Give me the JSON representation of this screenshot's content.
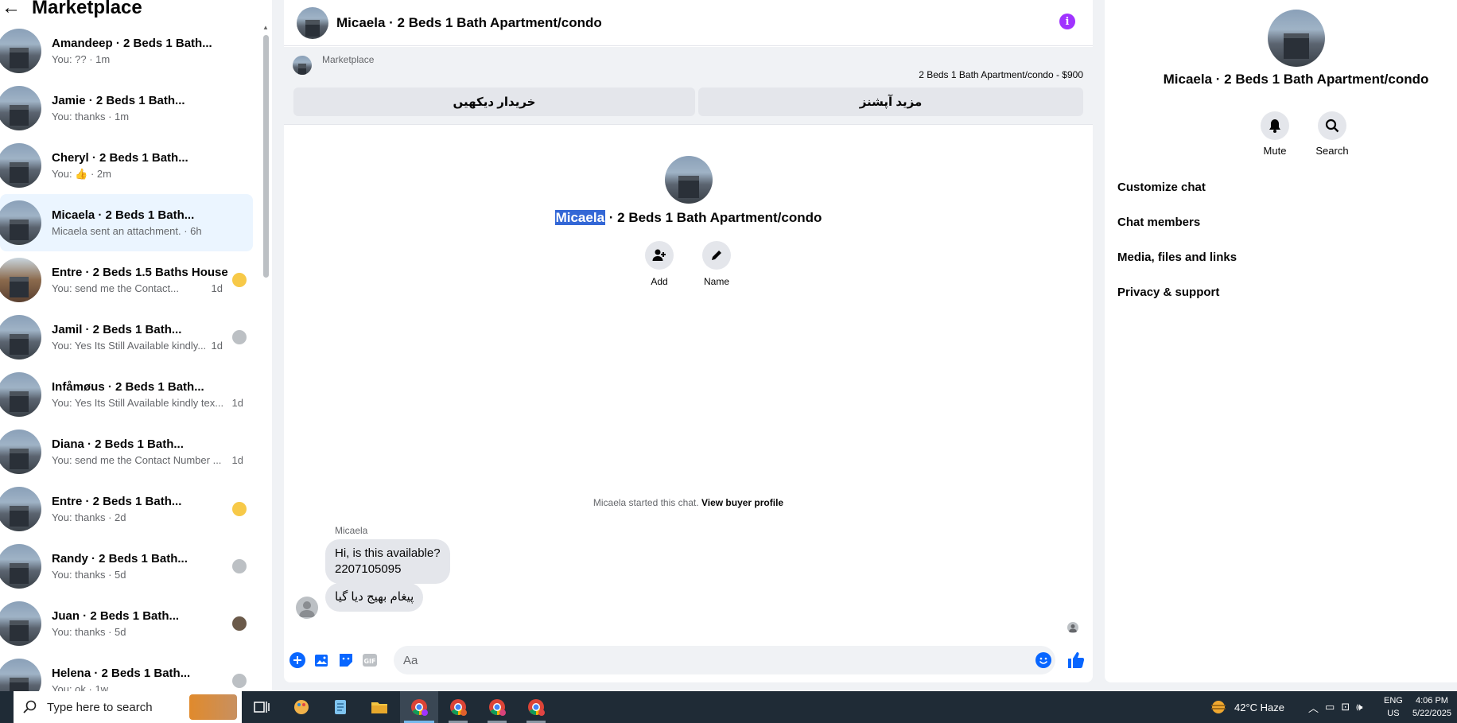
{
  "sidebar": {
    "title": "Marketplace",
    "conversations": [
      {
        "name": "Amandeep · 2 Beds 1 Bath...",
        "preview": "You: ?? · 1m",
        "badge": ""
      },
      {
        "name": "Jamie · 2 Beds 1 Bath...",
        "preview": "You: thanks · 1m",
        "badge": ""
      },
      {
        "name": "Cheryl · 2 Beds 1 Bath...",
        "preview": "You: 👍 · 2m",
        "badge": ""
      },
      {
        "name": "Micaela · 2 Beds 1 Bath...",
        "preview": "Micaela sent an attachment. · 6h",
        "badge": ""
      },
      {
        "name": "Entre · 2 Beds 1.5 Baths House",
        "preview": "You: send me the Contact...",
        "time": "1d",
        "badge": "emoji"
      },
      {
        "name": "Jamil · 2 Beds 1 Bath...",
        "preview": "You: Yes Its Still Available kindly...",
        "time": "1d",
        "badge": "person"
      },
      {
        "name": "Infåmøus · 2 Beds 1 Bath...",
        "preview": "You: Yes Its Still Available kindly tex...",
        "time": "1d",
        "badge": ""
      },
      {
        "name": "Diana · 2 Beds 1 Bath...",
        "preview": "You: send me the Contact Number ...",
        "time": "1d",
        "badge": ""
      },
      {
        "name": "Entre · 2 Beds 1 Bath...",
        "preview": "You: thanks · 2d",
        "badge": "emoji"
      },
      {
        "name": "Randy · 2 Beds 1 Bath...",
        "preview": "You: thanks · 5d",
        "badge": "person"
      },
      {
        "name": "Juan · 2 Beds 1 Bath...",
        "preview": "You: thanks · 5d",
        "badge": "photo"
      },
      {
        "name": "Helena · 2 Beds 1 Bath...",
        "preview": "You: ok · 1w",
        "badge": "person"
      }
    ]
  },
  "chat": {
    "title": "Micaela · 2 Beds 1 Bath Apartment/condo",
    "banner": {
      "label": "Marketplace",
      "listing": "2 Beds 1 Bath Apartment/condo - $900",
      "btn_left": "خریدار دیکھیں",
      "btn_right": "مزید آپشنز"
    },
    "intro": {
      "name_highlight": "Micaela",
      "title_rest": " · 2 Beds 1 Bath Apartment/condo",
      "add_label": "Add",
      "name_label": "Name"
    },
    "started_text": "Micaela started this chat.",
    "started_link": "View buyer profile",
    "sender": "Micaela",
    "messages": [
      {
        "line1": "Hi, is this available?",
        "line2": "2207105095"
      },
      {
        "line1": "پیغام بھیج دیا گیا"
      }
    ],
    "composer_placeholder": "Aa"
  },
  "right": {
    "title": "Micaela · 2 Beds 1 Bath Apartment/condo",
    "mute_label": "Mute",
    "search_label": "Search",
    "menu": [
      "Customize chat",
      "Chat members",
      "Media, files and links",
      "Privacy & support"
    ]
  },
  "taskbar": {
    "search_placeholder": "Type here to search",
    "weather": "42°C  Haze",
    "lang1": "ENG",
    "lang2": "US",
    "time": "4:06 PM",
    "date": "5/22/2025"
  }
}
